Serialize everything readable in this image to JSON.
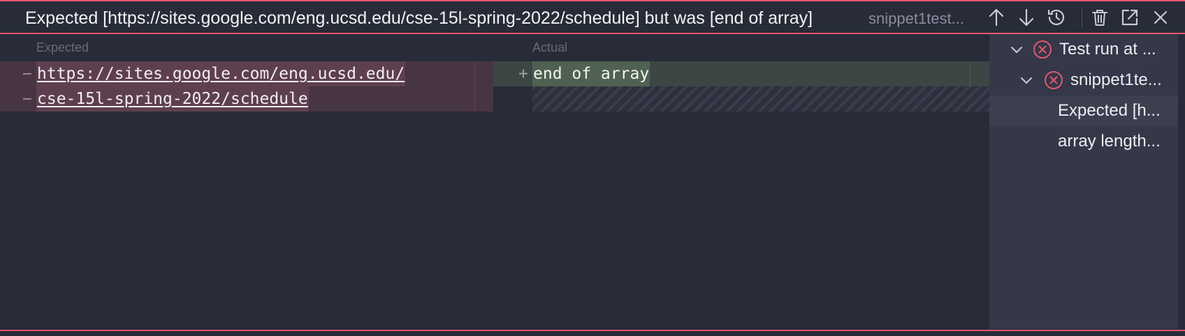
{
  "titlebar": {
    "title": "Expected [https://sites.google.com/eng.ucsd.edu/cse-15l-spring-2022/schedule] but was [end of array]",
    "subtitle": "snippet1test...",
    "icons": [
      "arrow-up-icon",
      "arrow-down-icon",
      "history-icon",
      "trash-icon",
      "open-external-icon",
      "close-icon"
    ]
  },
  "expected_pane": {
    "header": "Expected",
    "lines": [
      {
        "sign": "−",
        "text": "https://sites.google.com/eng.ucsd.edu/"
      },
      {
        "sign": "−",
        "text": "cse-15l-spring-2022/schedule"
      }
    ]
  },
  "actual_pane": {
    "header": "Actual",
    "lines": [
      {
        "sign": "+",
        "text": "end of array"
      }
    ]
  },
  "test_tree": {
    "items": [
      {
        "label": "Test run at ...",
        "status": "failed",
        "expanded": true
      },
      {
        "label": "snippet1te...",
        "status": "failed",
        "expanded": true
      },
      {
        "label": "Expected [h...",
        "selected": true
      },
      {
        "label": "array length..."
      }
    ]
  },
  "colors": {
    "accent_border": "#e8576c",
    "removed_bg": "#473543",
    "added_bg": "#3c4644",
    "error_icon": "#e8576c"
  }
}
